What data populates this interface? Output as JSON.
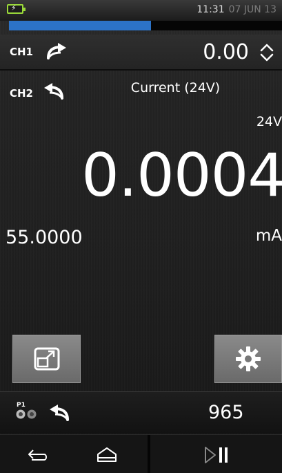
{
  "status_bar": {
    "time": "11:31",
    "date": "07 JUN 13",
    "battery_color": "#9ad93a"
  },
  "progress": {
    "fraction": 0.52,
    "color": "#2c73c8"
  },
  "ch1": {
    "label": "CH1",
    "icon": "arrow-out-icon",
    "value": "0.00",
    "stepper_icon": "up-down-icon"
  },
  "ch2": {
    "label": "CH2",
    "icon": "arrow-in-icon",
    "function": "Current (24V)",
    "supply": "24V",
    "reading": "0.0004",
    "range": "55.0000",
    "unit": "mA"
  },
  "buttons": {
    "expand_icon": "expand-icon",
    "settings_icon": "gear-icon"
  },
  "p1": {
    "label": "P1",
    "icon": "arrow-in-icon",
    "value": "965"
  },
  "nav": {
    "back_icon": "back-icon",
    "home_icon": "home-icon",
    "playpause_icon": "play-pause-icon"
  }
}
